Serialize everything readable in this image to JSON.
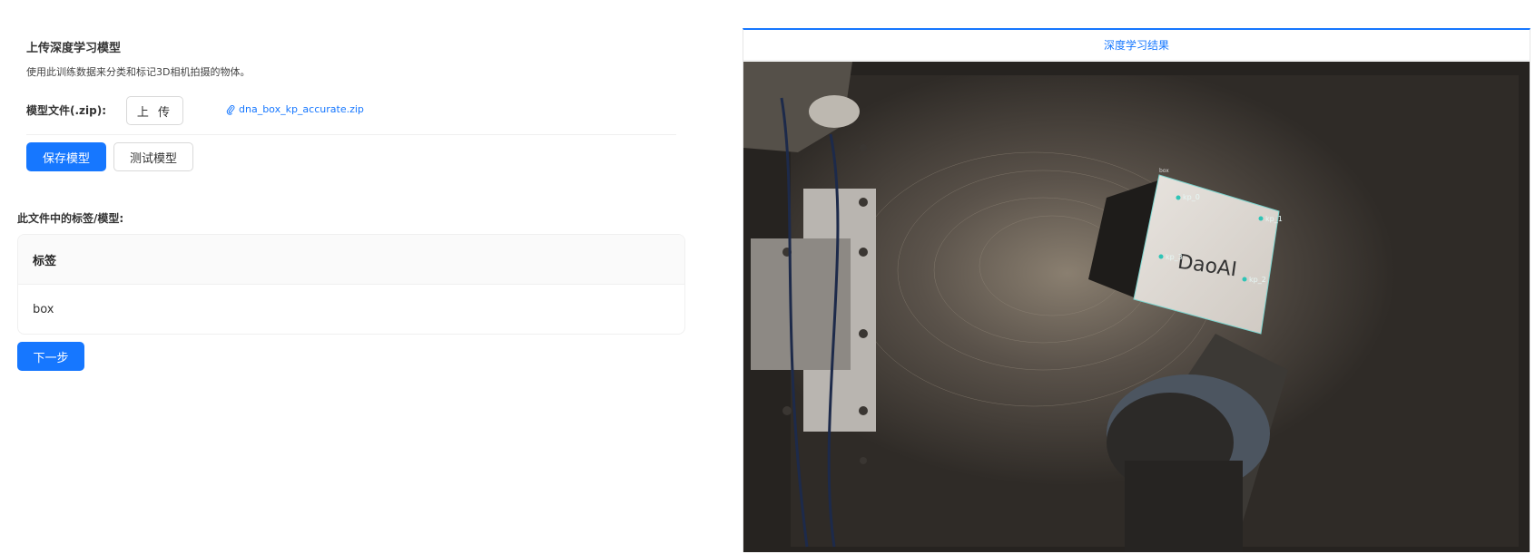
{
  "upload": {
    "title": "上传深度学习模型",
    "description": "使用此训练数据来分类和标记3D相机拍摄的物体。",
    "file_label": "模型文件(.zip):",
    "upload_button": "上 传",
    "file_name": "dna_box_kp_accurate.zip",
    "file_icon": "paperclip-icon"
  },
  "actions": {
    "save_label": "保存模型",
    "test_label": "测试模型"
  },
  "labels": {
    "title": "此文件中的标签/模型:",
    "column_header": "标签",
    "rows": [
      "box"
    ]
  },
  "next_label": "下一步",
  "result": {
    "title": "深度学习结果",
    "box_text": "DaoAI",
    "keypoints": [
      "kp_0",
      "kp_1",
      "kp_2",
      "kp_3"
    ],
    "colors": {
      "accent": "#1677ff",
      "keypoint": "#2ec4b6"
    }
  }
}
